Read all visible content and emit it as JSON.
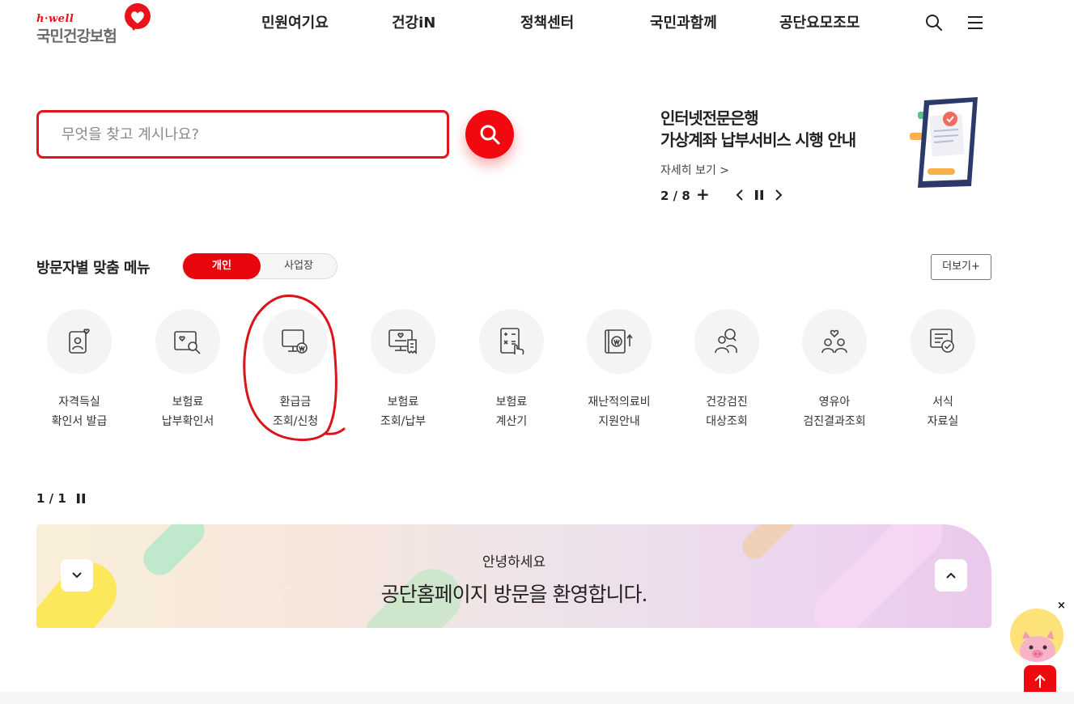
{
  "header": {
    "logo_sub": "h·well",
    "logo_main": "국민건강보험",
    "nav": [
      "민원여기요",
      "건강iN",
      "정책센터",
      "국민과함께",
      "공단요모조모"
    ]
  },
  "search": {
    "placeholder": "무엇을 찾고 계시나요?"
  },
  "promo": {
    "title_line1": "인터넷전문은행",
    "title_line2": "가상계좌 납부서비스 시행 안내",
    "more_label": "자세히 보기 >",
    "pager": "2 / 8",
    "plus_symbol": "+"
  },
  "visitor_menu": {
    "title": "방문자별 맞춤 메뉴",
    "tab_active": "개인",
    "tab_inactive": "사업장",
    "more_button": "더보기+",
    "items": [
      {
        "line1": "자격득실",
        "line2": "확인서 발급",
        "icon": "id-card-heart-icon"
      },
      {
        "line1": "보험료",
        "line2": "납부확인서",
        "icon": "document-search-icon"
      },
      {
        "line1": "환급금",
        "line2": "조회/신청",
        "icon": "monitor-won-icon"
      },
      {
        "line1": "보험료",
        "line2": "조회/납부",
        "icon": "monitor-receipt-icon"
      },
      {
        "line1": "보험료",
        "line2": "계산기",
        "icon": "calculator-hand-icon"
      },
      {
        "line1": "재난적의료비",
        "line2": "지원안내",
        "icon": "book-won-up-icon"
      },
      {
        "line1": "건강검진",
        "line2": "대상조회",
        "icon": "people-search-icon"
      },
      {
        "line1": "영유아",
        "line2": "검진결과조회",
        "icon": "family-heart-icon"
      },
      {
        "line1": "서식",
        "line2": "자료실",
        "icon": "form-check-icon"
      }
    ],
    "pager": "1 / 1"
  },
  "banner": {
    "line_small": "안녕하세요",
    "line_big": "공단홈페이지 방문을 환영합니다."
  },
  "floating": {
    "close_symbol": "×"
  },
  "colors": {
    "brand_red": "#e8060d",
    "logo_gray": "#6b6b6b",
    "annotation_red": "#d9141b"
  }
}
